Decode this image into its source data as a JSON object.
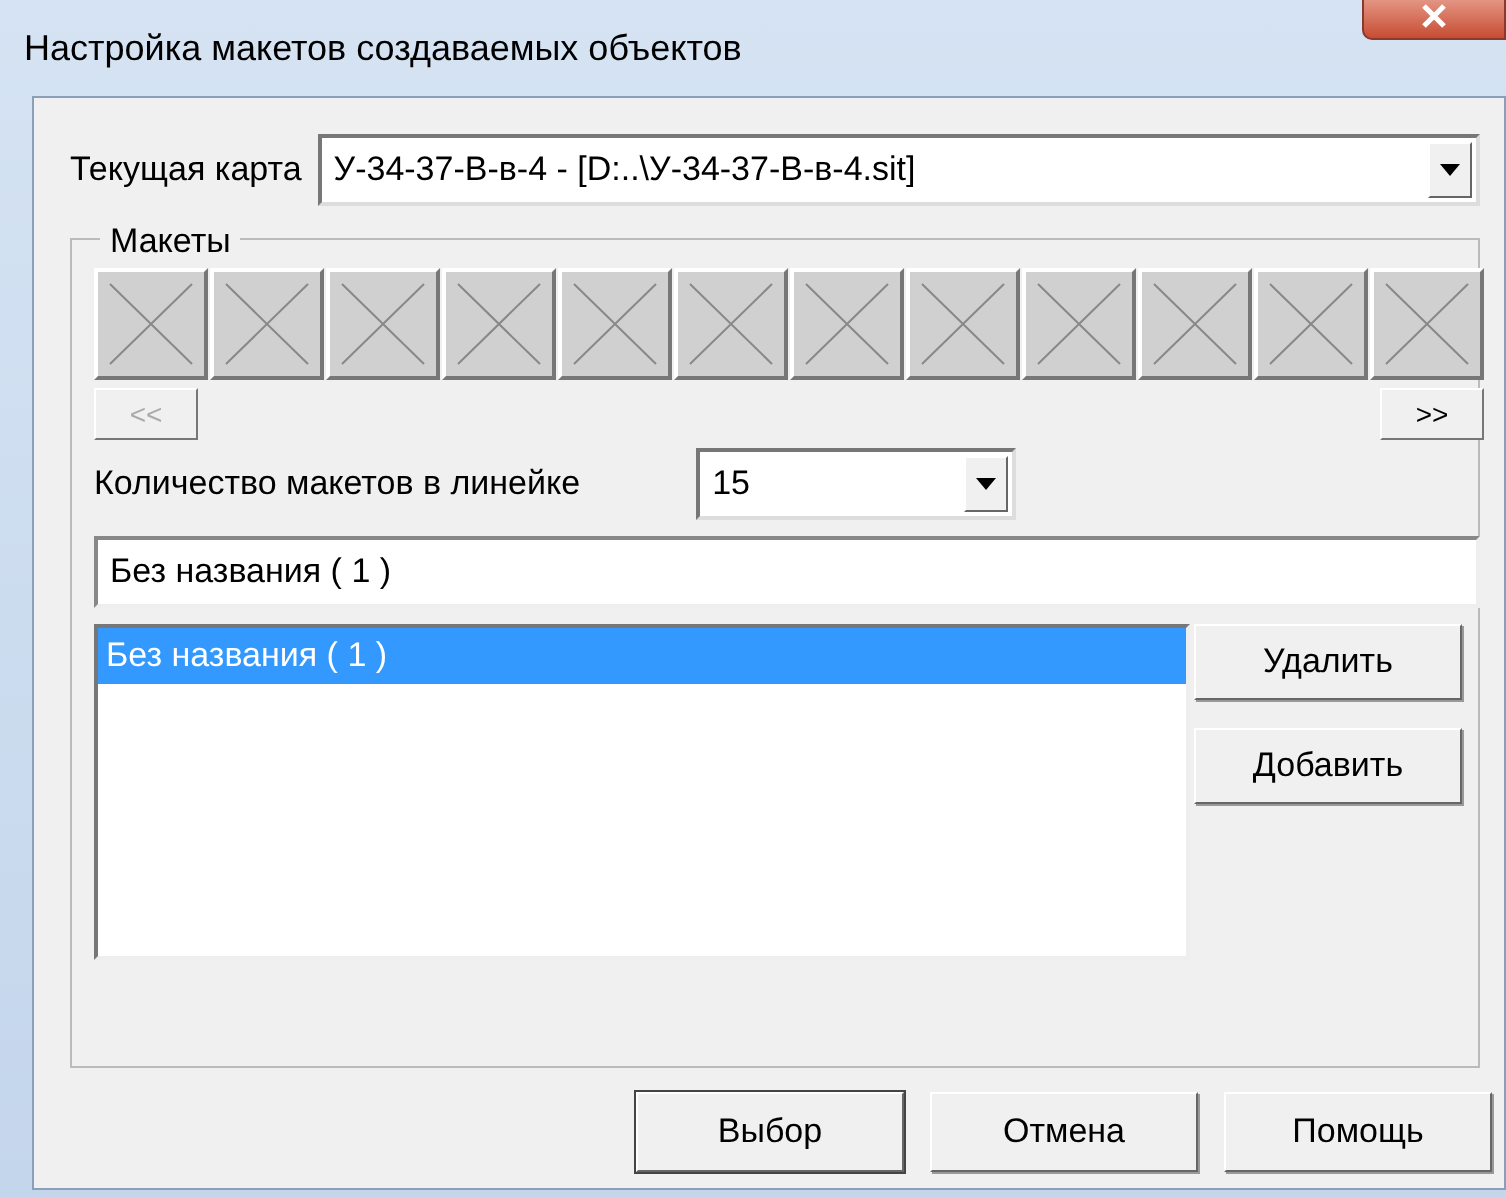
{
  "window": {
    "title": "Настройка макетов создаваемых объектов"
  },
  "current_map": {
    "label": "Текущая карта",
    "value": "У-34-37-В-в-4 - [D:..\\У-34-37-В-в-4.sit]"
  },
  "layouts": {
    "label": "Макеты",
    "tiles": [
      {
        "kind": "empty"
      },
      {
        "kind": "empty"
      },
      {
        "kind": "empty"
      },
      {
        "kind": "empty"
      },
      {
        "kind": "empty"
      },
      {
        "kind": "empty"
      },
      {
        "kind": "empty"
      },
      {
        "kind": "empty"
      },
      {
        "kind": "empty"
      },
      {
        "kind": "empty"
      },
      {
        "kind": "empty"
      },
      {
        "kind": "empty"
      }
    ],
    "scroll_buttons": [
      {
        "label": "<<",
        "disabled": true
      },
      {
        "label": ">>",
        "disabled": false
      }
    ],
    "count": {
      "label": "Количество макетов в линейке",
      "value": "15"
    },
    "name_field": {
      "value": "Без названия  ( 1 )"
    },
    "list": [
      {
        "label": "Без названия  ( 1 )",
        "selected": true
      }
    ],
    "side_buttons": [
      "Удалить",
      "Добавить"
    ]
  },
  "buttons": [
    {
      "label": "Выбор",
      "default": true
    },
    {
      "label": "Отмена",
      "default": false
    },
    {
      "label": "Помощь",
      "default": false
    }
  ]
}
